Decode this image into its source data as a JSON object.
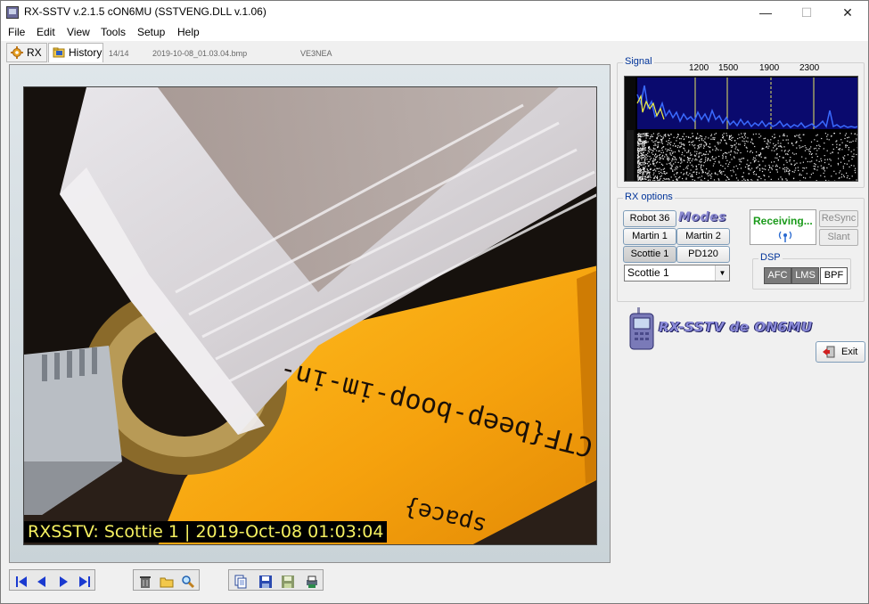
{
  "window": {
    "title": "RX-SSTV v.2.1.5 cON6MU (SSTVENG.DLL v.1.06)",
    "minimize": "—",
    "maximize": "☐",
    "close": "✕"
  },
  "menu": [
    "File",
    "Edit",
    "View",
    "Tools",
    "Setup",
    "Help"
  ],
  "tabs": {
    "rx_label": "RX",
    "history_label": "History",
    "counter": "14/14",
    "filename": "2019-10-08_01.03.04.bmp",
    "callsign": "VE3NEA"
  },
  "image": {
    "overlay_text": "RXSSTV: Scottie 1 | 2019-Oct-08 01:03:04",
    "card_text_line1": "CTF{beep-boop-im-in-",
    "card_text_line2": "space}"
  },
  "toolbar": {
    "nav_icons": [
      "first-icon",
      "prev-icon",
      "next-icon",
      "last-icon"
    ],
    "file_icons": [
      "trash-icon",
      "open-folder-icon",
      "zoom-icon"
    ],
    "save_icons": [
      "copy-icon",
      "save-icon",
      "save-all-icon",
      "scan-icon"
    ]
  },
  "signal": {
    "group_label": "Signal",
    "freq_labels": [
      "1200",
      "1500",
      "1900",
      "2300"
    ]
  },
  "rx_options": {
    "group_label": "RX options",
    "modes_logo": "Modes",
    "mode_buttons": [
      "Robot 36",
      "Martin 1",
      "Martin 2",
      "Scottie 1",
      "PD120"
    ],
    "selected_mode": "Scottie 1",
    "combo_value": "Scottie 1",
    "status_text": "Receiving...",
    "resync_label": "ReSync",
    "slant_label": "Slant",
    "dsp_label": "DSP",
    "dsp_buttons": [
      {
        "label": "AFC",
        "state": "on"
      },
      {
        "label": "LMS",
        "state": "on"
      },
      {
        "label": "BPF",
        "state": "off"
      }
    ]
  },
  "branding": {
    "logo_text": "RX-SSTV de ON6MU"
  },
  "exit_label": "Exit",
  "colors": {
    "status_green": "#1a9a1a",
    "overlay_yellow": "#f5f060",
    "spectrum_bg": "#0a0a6e",
    "spectrum_line": "#3a6bff"
  }
}
